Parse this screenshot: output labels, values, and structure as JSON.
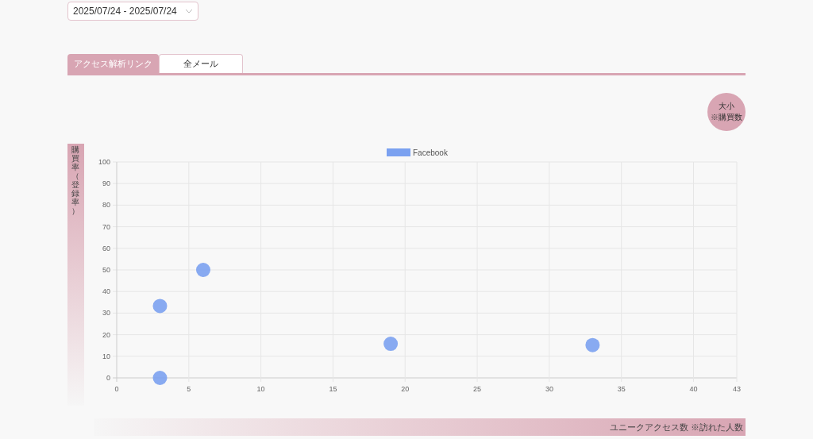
{
  "date_range": {
    "value": "2025/07/24 - 2025/07/24"
  },
  "tabs": [
    {
      "label": "アクセス解析リンク",
      "selected": true
    },
    {
      "label": "全メール",
      "selected": false
    }
  ],
  "size_legend": {
    "line_1": "大小",
    "line_2": "※購買数"
  },
  "y_axis_label": "購買率（登録率）",
  "x_axis_label": "ユニークアクセス数 ※訪れた人数",
  "chart_data": {
    "type": "scatter",
    "xlim": [
      0,
      43
    ],
    "ylim": [
      0,
      100
    ],
    "xticks": [
      0,
      5,
      10,
      15,
      20,
      25,
      30,
      35,
      40,
      43
    ],
    "yticks": [
      0,
      10,
      20,
      30,
      40,
      50,
      60,
      70,
      80,
      90,
      100
    ],
    "grid": true,
    "series": [
      {
        "name": "Facebook",
        "color": "#7ba1f0",
        "x": [
          3,
          3,
          6,
          19,
          33
        ],
        "values": [
          0,
          33.3,
          50,
          15.8,
          15.2
        ]
      }
    ]
  }
}
